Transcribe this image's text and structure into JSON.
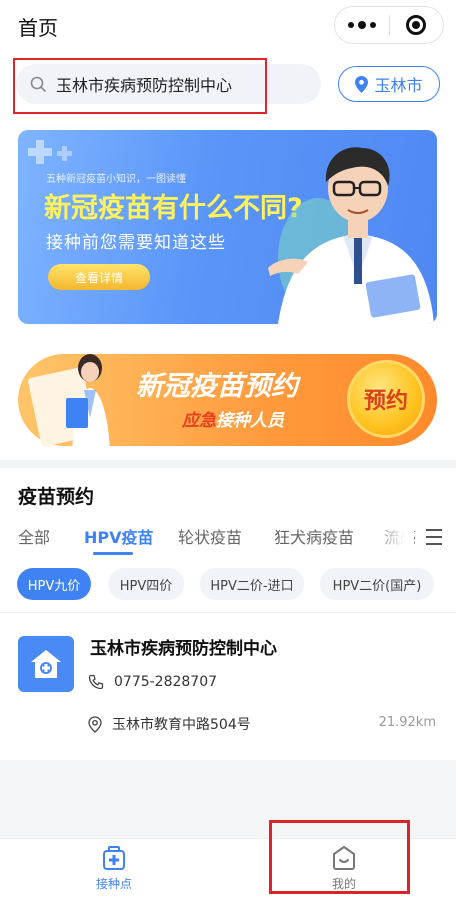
{
  "header": {
    "title": "首页"
  },
  "search": {
    "text": "玉林市疾病预防控制中心",
    "city": "玉林市"
  },
  "banner1": {
    "caption": "五种新冠疫苗小知识，一图读懂",
    "headline": "新冠疫苗有什么不同?",
    "subline": "接种前您需要知道这些",
    "button": "查看详情"
  },
  "banner2": {
    "title": "新冠疫苗预约",
    "subline_highlight": "应急",
    "subline_rest": "接种人员",
    "badge": "预约"
  },
  "section": {
    "title": "疫苗预约"
  },
  "tabs": [
    {
      "label": "全部"
    },
    {
      "label": "HPV疫苗"
    },
    {
      "label": "轮状疫苗"
    },
    {
      "label": "狂犬病疫苗"
    },
    {
      "label": "流感"
    }
  ],
  "chips": [
    {
      "label": "HPV九价"
    },
    {
      "label": "HPV四价"
    },
    {
      "label": "HPV二价-进口"
    },
    {
      "label": "HPV二价(国产)"
    }
  ],
  "clinic": {
    "name": "玉林市疾病预防控制中心",
    "phone": "0775-2828707",
    "address": "玉林市教育中路504号",
    "distance": "21.92km"
  },
  "tabbar": {
    "items": [
      {
        "label": "接种点"
      },
      {
        "label": "我的"
      }
    ]
  },
  "colors": {
    "accent": "#3f82f4",
    "highlight_box": "#e0262b"
  },
  "icons": [
    "search-icon",
    "location-pin-icon",
    "menu-icon",
    "phone-icon",
    "map-pin-icon",
    "clinic-icon",
    "medical-kit-icon",
    "profile-icon"
  ]
}
